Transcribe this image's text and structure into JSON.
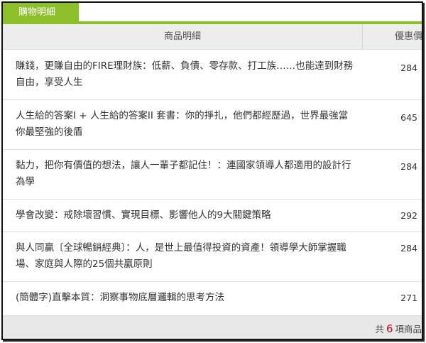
{
  "tab": {
    "label": "購物明細"
  },
  "table": {
    "col_title": "商品明細",
    "col_price": "優惠價",
    "rows": [
      {
        "title": "賺錢，更賺自由的FIRE理財族：低薪、負債、零存款、打工族……也能達到財務自由，享受人生",
        "price": "284"
      },
      {
        "title": "人生給的答案I + 人生給的答案II 套書：你的掙扎，他們都經歷過，世界最強當你最堅強的後盾",
        "price": "645"
      },
      {
        "title": "黏力，把你有價值的想法，讓人一輩子都記住！：連國家領導人都適用的設計行為學",
        "price": "284"
      },
      {
        "title": "學會改變：戒除壞習慣、實現目標、影響他人的9大關鍵策略",
        "price": "292"
      },
      {
        "title": "與人同贏〔全球暢銷經典〕：人，是世上最值得投資的資產！領導學大師掌握職場、家庭與人際的25個共贏原則",
        "price": "284"
      },
      {
        "title": "(簡體字)直擊本質：洞察事物底層邏輯的思考方法",
        "price": "271"
      }
    ]
  },
  "footer": {
    "prefix": "共",
    "count": "6",
    "suffix": "項商品"
  }
}
